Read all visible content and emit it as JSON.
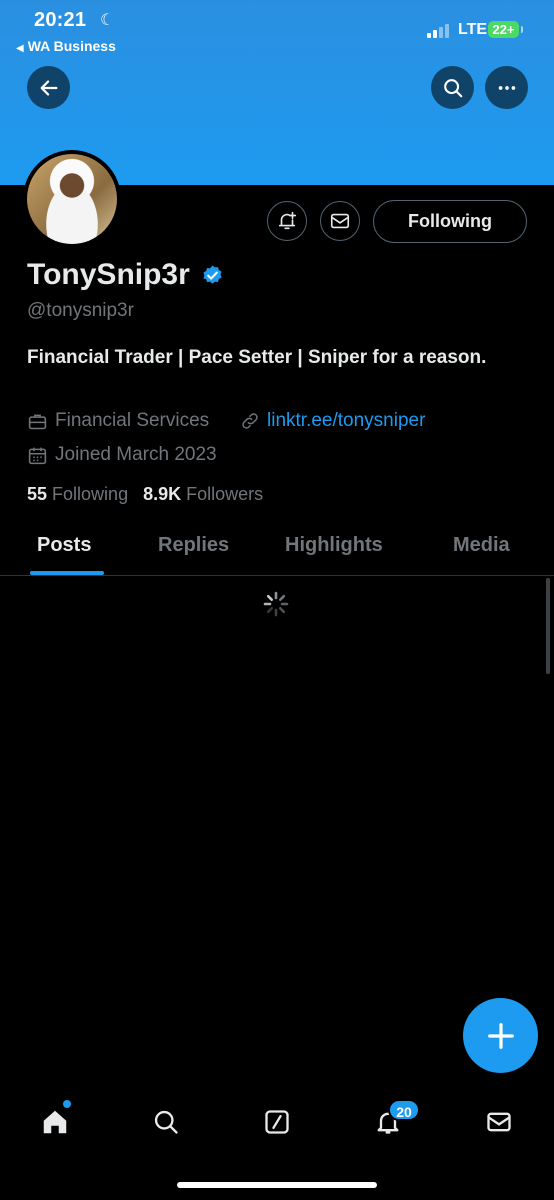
{
  "status_bar": {
    "time": "20:21",
    "back_app": "WA Business",
    "network": "LTE",
    "battery": "22+"
  },
  "icons": {
    "back": "arrow-left-icon",
    "search": "search-icon",
    "more": "more-horizontal-icon",
    "notifications": "bell-plus-icon",
    "message": "envelope-icon",
    "verified": "verified-badge-icon",
    "category": "briefcase-icon",
    "link": "link-icon",
    "joined": "calendar-icon"
  },
  "profile": {
    "display_name": "TonySnip3r",
    "handle": "@tonysnip3r",
    "bio": "Financial Trader | Pace Setter | Sniper for a reason.",
    "category": "Financial Services",
    "link": "linktr.ee/tonysniper",
    "joined": "Joined March 2023",
    "following_count": "55",
    "following_label": "Following",
    "followers_count": "8.9K",
    "followers_label": "Followers",
    "follow_button": "Following"
  },
  "tabs": [
    {
      "label": "Posts",
      "active": true
    },
    {
      "label": "Replies",
      "active": false
    },
    {
      "label": "Highlights",
      "active": false
    },
    {
      "label": "Media",
      "active": false
    }
  ],
  "bottom_nav": {
    "items": [
      "home-icon",
      "search-icon",
      "grok-icon",
      "notifications-icon",
      "messages-icon"
    ],
    "notifications_badge": "20"
  },
  "colors": {
    "accent": "#1d9bf0",
    "background": "#000000",
    "muted_text": "#71767b",
    "primary_text": "#e7e9ea"
  }
}
